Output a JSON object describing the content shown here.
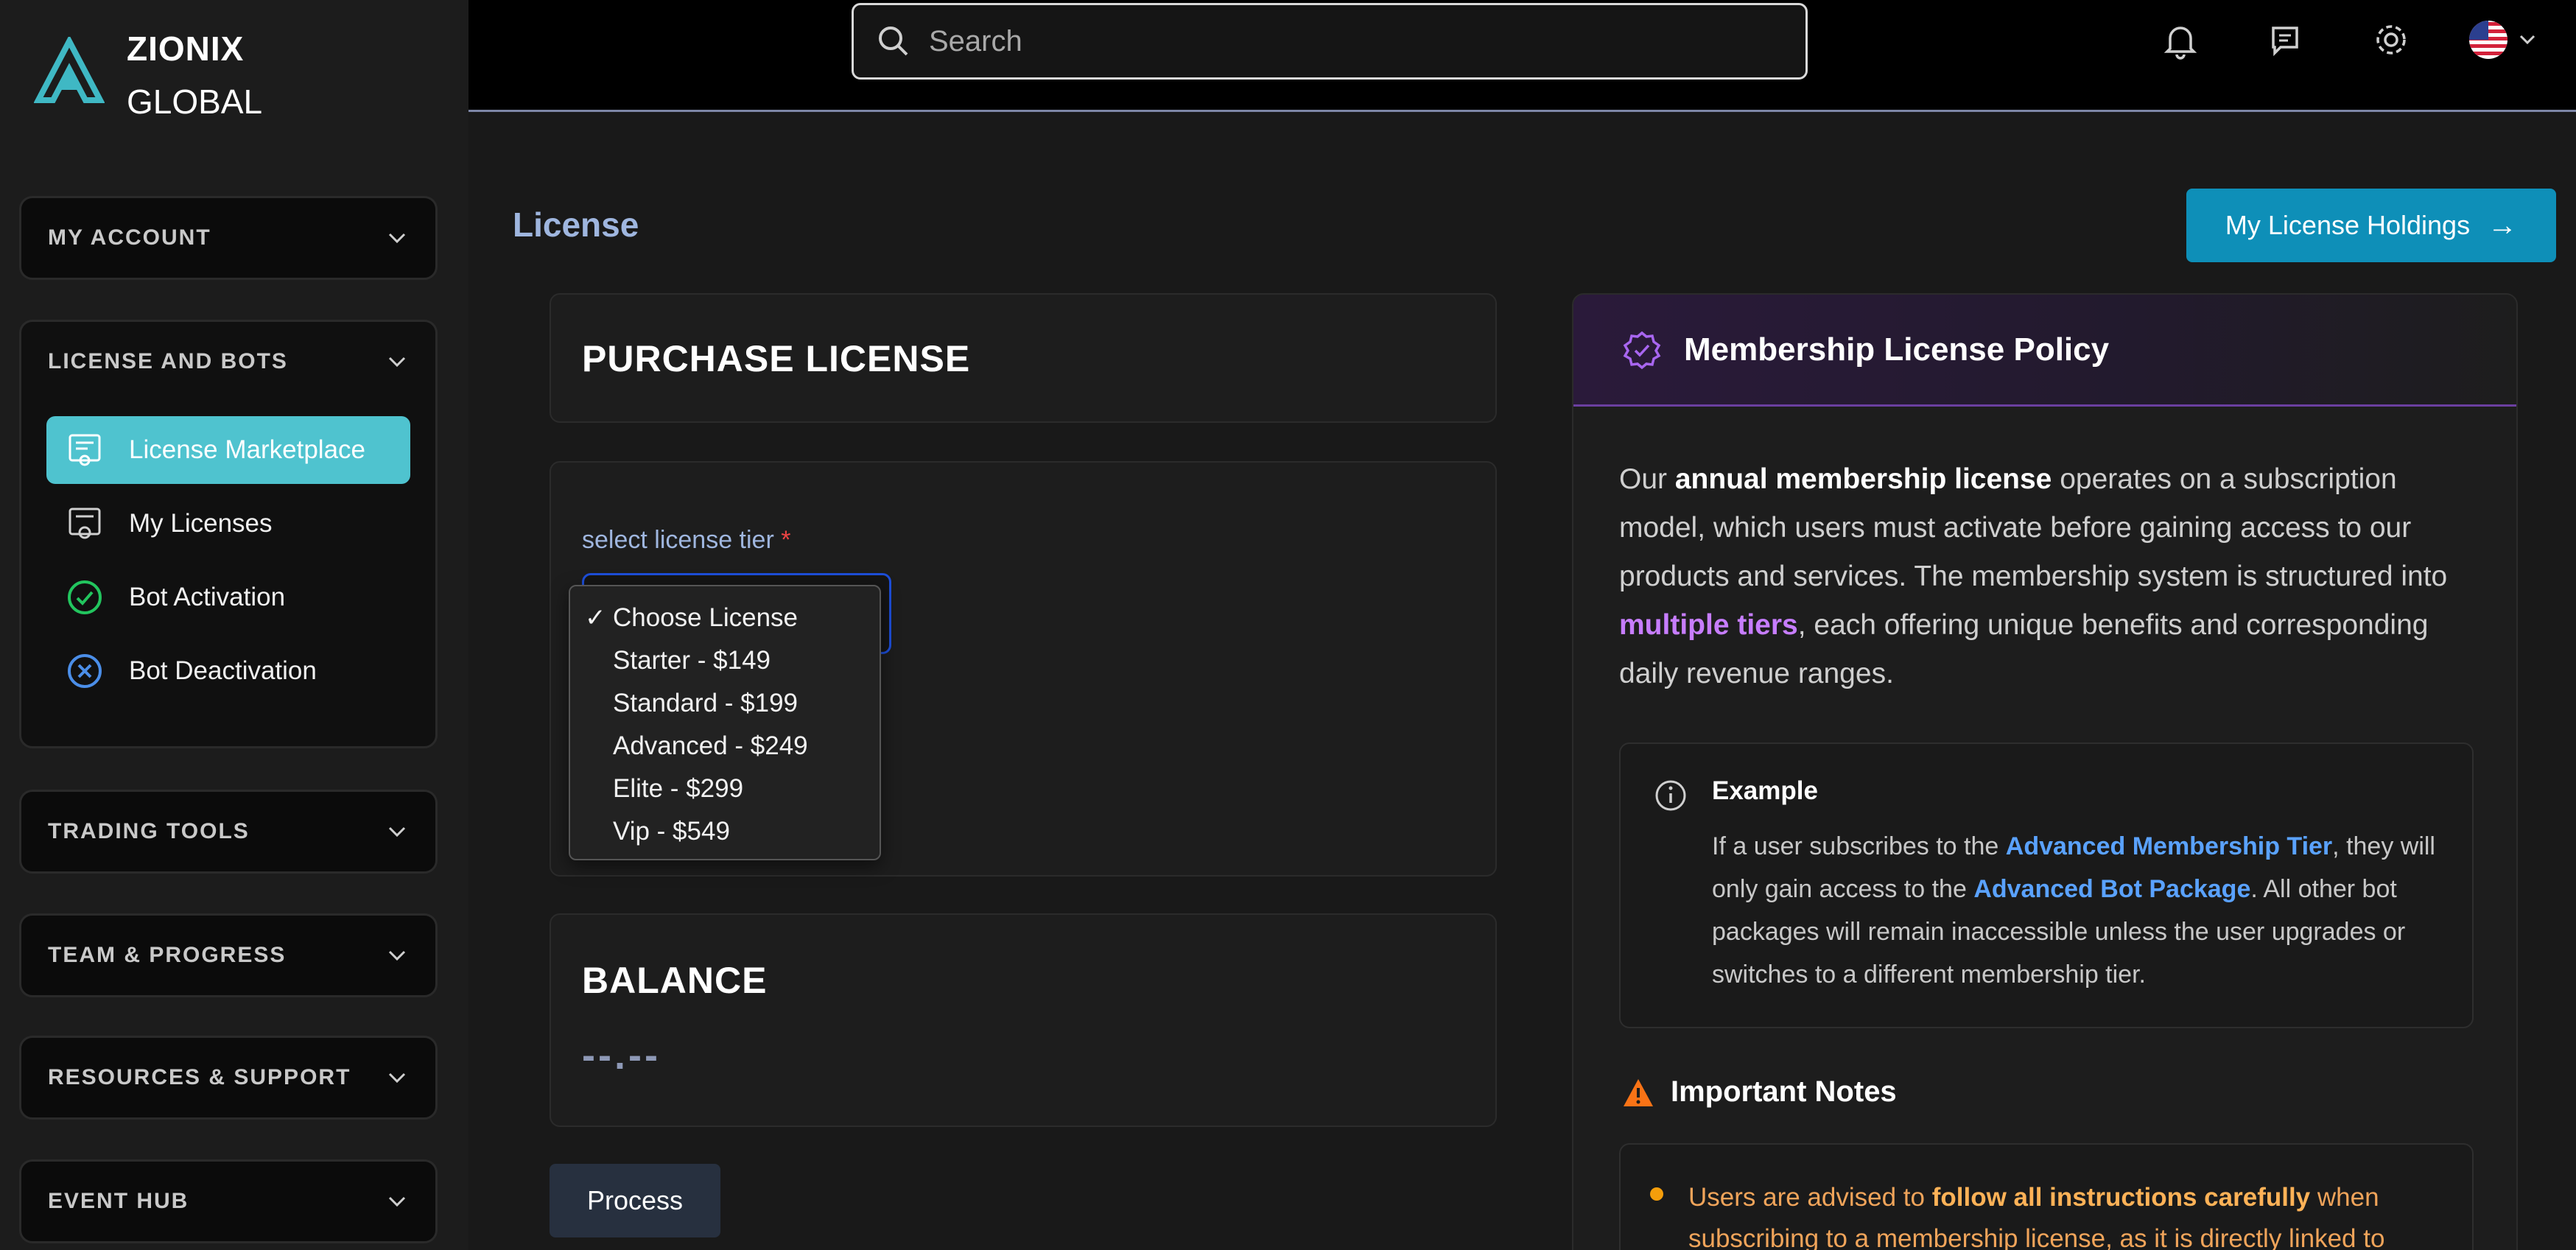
{
  "brand": {
    "line1": "ZIONIX",
    "line2": "GLOBAL"
  },
  "sidebar": {
    "sections": [
      {
        "title": "MY ACCOUNT"
      },
      {
        "title": "LICENSE AND BOTS",
        "items": [
          {
            "label": "License Marketplace",
            "icon": "certificate-icon",
            "active": true
          },
          {
            "label": "My Licenses",
            "icon": "badge-icon"
          },
          {
            "label": "Bot Activation",
            "icon": "check-circle-icon"
          },
          {
            "label": "Bot Deactivation",
            "icon": "x-circle-icon"
          }
        ]
      },
      {
        "title": "TRADING TOOLS"
      },
      {
        "title": "TEAM & PROGRESS"
      },
      {
        "title": "RESOURCES & SUPPORT"
      },
      {
        "title": "EVENT HUB"
      }
    ]
  },
  "search": {
    "placeholder": "Search"
  },
  "page": {
    "title": "License",
    "holdings_label": "My License Holdings",
    "holdings_arrow": "→"
  },
  "purchase": {
    "title": "PURCHASE LICENSE",
    "tier_label": "select license tier",
    "required_mark": "*",
    "options": [
      "Choose License",
      "Starter - $149",
      "Standard - $199",
      "Advanced - $249",
      "Elite - $299",
      "Vip - $549"
    ],
    "selected_check": "✓"
  },
  "balance": {
    "title": "BALANCE",
    "value": "--.--"
  },
  "process_label": "Process",
  "policy": {
    "title": "Membership License Policy",
    "p1_a": "Our ",
    "p1_b": "annual membership license",
    "p1_c": " operates on a subscription model, which users must activate before gaining access to our products and services. The membership system is structured into ",
    "p1_d": "multiple tiers",
    "p1_e": ", each offering unique benefits and corresponding daily revenue ranges.",
    "example_title": "Example",
    "ex_a": "If a user subscribes to the ",
    "ex_b": "Advanced Membership Tier",
    "ex_c": ", they will only gain access to the ",
    "ex_d": "Advanced Bot Package",
    "ex_e": ". All other bot packages will remain inaccessible unless the user upgrades or switches to a different membership tier.",
    "notes_title": "Important Notes",
    "note_a": "Users are advised to ",
    "note_b": "follow all instructions carefully",
    "note_c": " when subscribing to a membership license, as it is directly linked to"
  },
  "colors": {
    "accent": "#4fc3cf",
    "button": "#0e8fb8",
    "purple": "#c77dff",
    "link": "#5aa2ff",
    "warning": "#f59e0b"
  }
}
